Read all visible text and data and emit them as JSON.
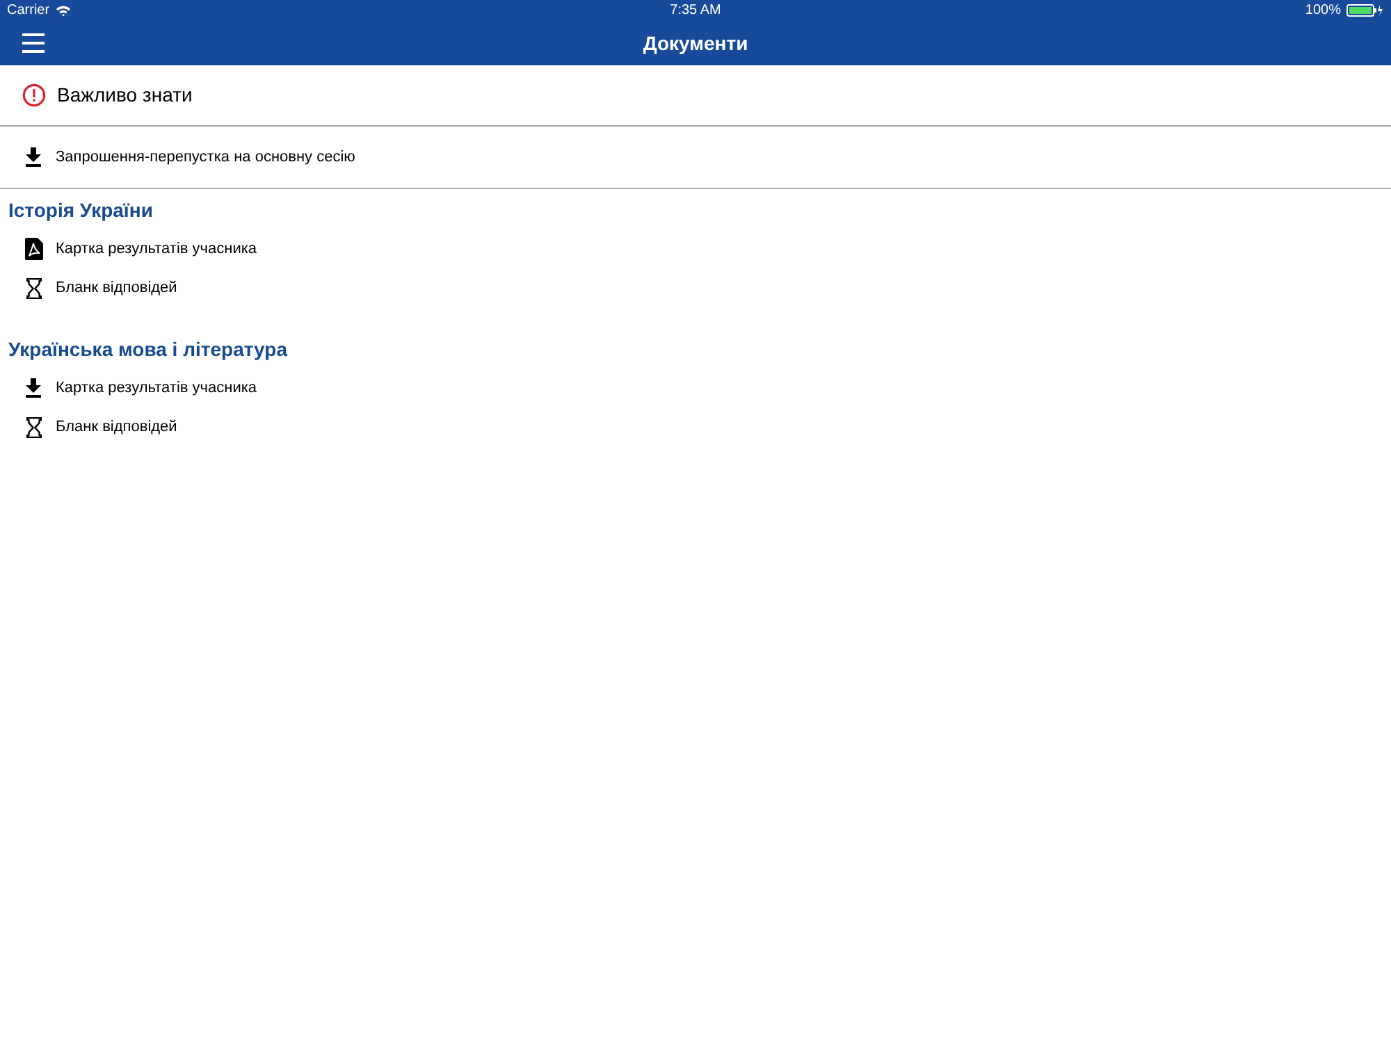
{
  "status_bar": {
    "carrier": "Carrier",
    "time": "7:35 AM",
    "battery": "100%"
  },
  "nav_bar": {
    "title": "Документи"
  },
  "notice": {
    "label": "Важливо знати"
  },
  "top_items": [
    {
      "kind": "download",
      "label": "Запрошення-перепустка на основну сесію"
    }
  ],
  "sections": [
    {
      "title": "Історія України",
      "items": [
        {
          "kind": "pdf",
          "label": "Картка результатів учасника"
        },
        {
          "kind": "pending",
          "label": "Бланк відповідей"
        }
      ]
    },
    {
      "title": "Українська мова і література",
      "items": [
        {
          "kind": "download",
          "label": "Картка результатів учасника"
        },
        {
          "kind": "pending",
          "label": "Бланк відповідей"
        }
      ]
    }
  ]
}
